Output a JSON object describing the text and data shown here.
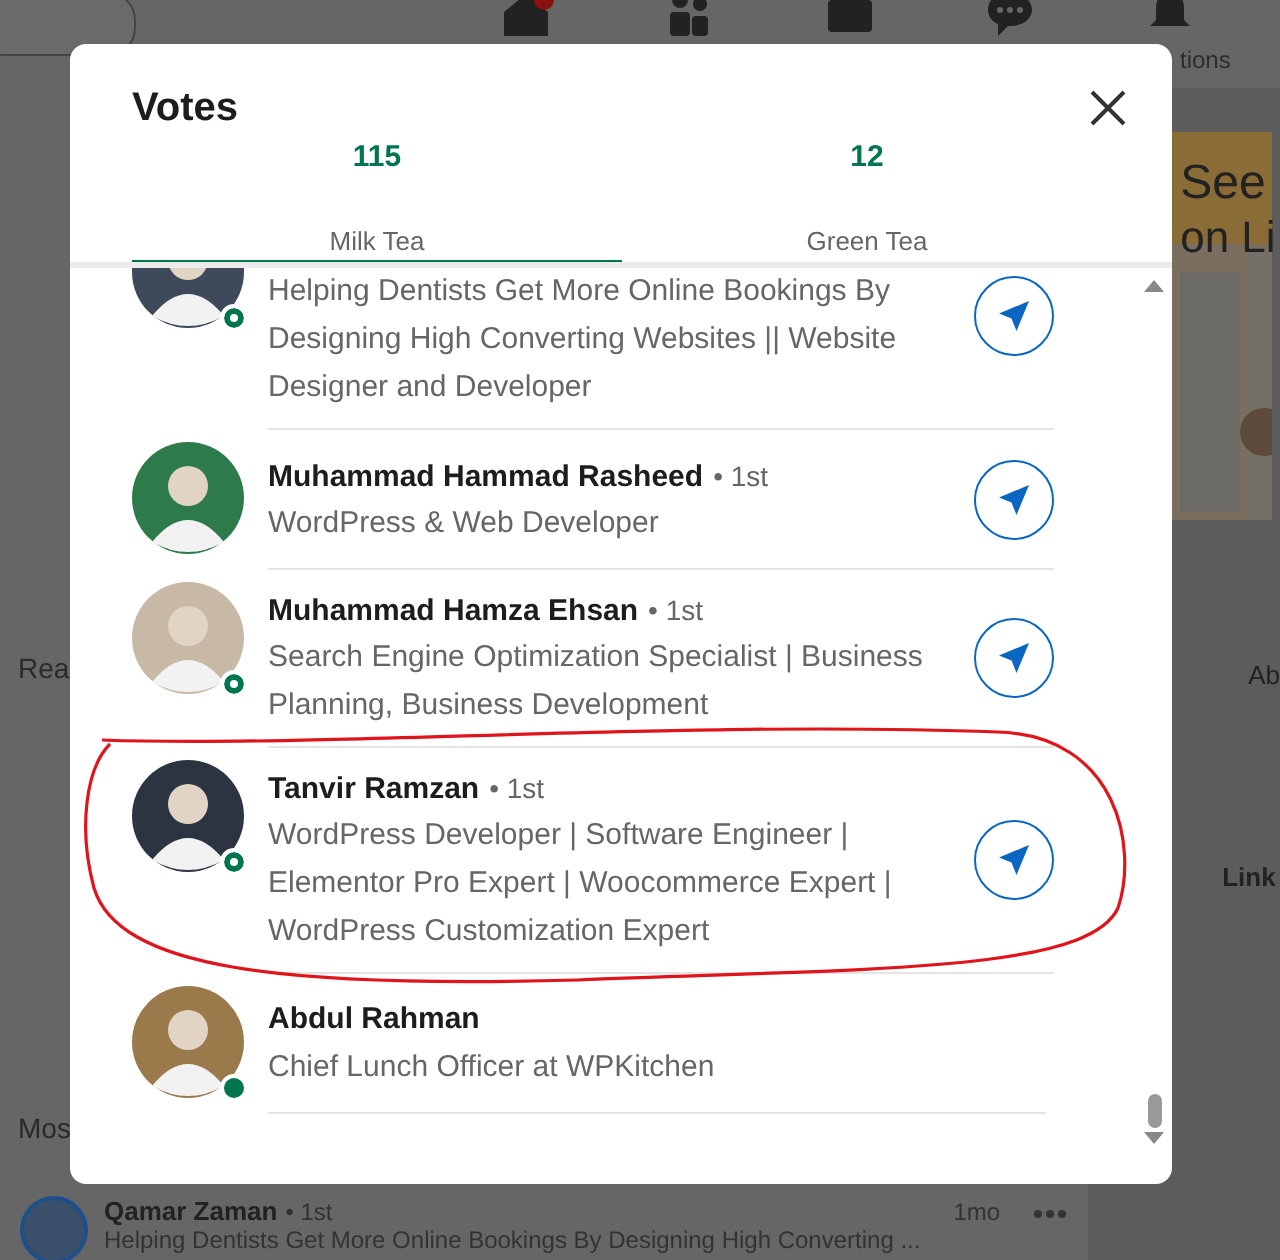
{
  "background": {
    "nav_label": "tions",
    "feed_labels": [
      "Rea",
      "Mos"
    ],
    "ad_texts": [
      "See",
      "on Li"
    ],
    "side_texts": [
      "Ab",
      "Link"
    ],
    "post": {
      "name": "Qamar Zaman",
      "degree": "• 1st",
      "time": "1mo",
      "headline": "Helping Dentists Get More Online Bookings By Designing High Converting ..."
    }
  },
  "modal": {
    "title": "Votes",
    "tabs": [
      {
        "count": "115",
        "label": "Milk Tea",
        "selected": true
      },
      {
        "count": "12",
        "label": "Green Tea",
        "selected": false
      }
    ],
    "voters": [
      {
        "headline": "Helping Dentists Get More Online Bookings By Designing High Converting Websites || Website Designer and Developer",
        "online": true,
        "active": false,
        "can_message": true,
        "highlighted": false
      },
      {
        "name": "Muhammad Hammad Rasheed",
        "degree": "• 1st",
        "headline": "WordPress & Web Developer",
        "online": false,
        "can_message": true,
        "highlighted": false
      },
      {
        "name": "Muhammad Hamza Ehsan",
        "degree": "• 1st",
        "headline": "Search Engine Optimization Specialist | Business Planning, Business Development",
        "online": true,
        "active": false,
        "can_message": true,
        "highlighted": false
      },
      {
        "name": "Tanvir Ramzan",
        "degree": "• 1st",
        "headline": "WordPress Developer | Software Engineer | Elementor Pro Expert | Woocommerce Expert | WordPress Customization Expert",
        "online": true,
        "active": false,
        "can_message": true,
        "highlighted": true
      },
      {
        "name": "Abdul Rahman",
        "headline": "Chief Lunch Officer at WPKitchen",
        "online": true,
        "active": true,
        "can_message": false,
        "highlighted": false
      }
    ]
  }
}
